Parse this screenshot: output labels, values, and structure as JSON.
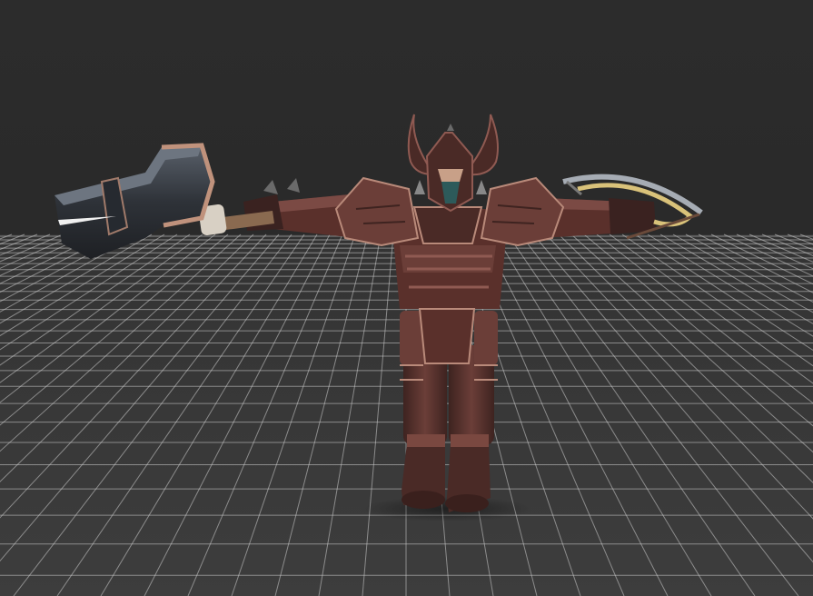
{
  "scene": {
    "background_color": "#2b2b2b",
    "floor_color": "#3a3a3a",
    "grid_line_color": "#cfcfcf",
    "character_palette": {
      "armor_dark": "#4a2a26",
      "armor_mid": "#6b3e38",
      "armor_light": "#8f5a52",
      "trim": "#b98a7a",
      "metal": "#3c4046",
      "metal_highlight": "#c8b8a8",
      "bow_gold": "#d9c27a",
      "bow_silver": "#a6acb4"
    },
    "subject": "armored-warrior-t-pose",
    "left_hand_item": "hammer",
    "right_hand_item": "crossbow"
  }
}
